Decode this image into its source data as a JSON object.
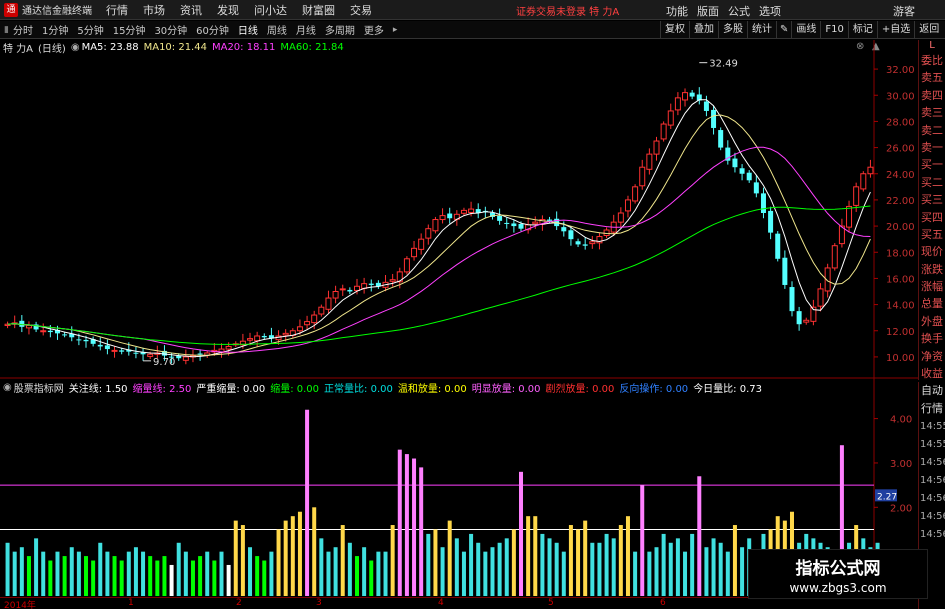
{
  "menubar": {
    "logo": "通",
    "title": "通达信金融终端",
    "items": [
      "行情",
      "市场",
      "资讯",
      "发现",
      "问小达",
      "财富圈",
      "交易"
    ],
    "trade_status": "证券交易未登录  特 力A",
    "right_items": [
      "功能",
      "版面",
      "公式",
      "选项"
    ],
    "guest": "游客"
  },
  "toolbar": {
    "periods": [
      "分时",
      "1分钟",
      "5分钟",
      "15分钟",
      "30分钟",
      "60分钟",
      "日线",
      "周线",
      "月线",
      "多周期",
      "更多"
    ],
    "active": "日线",
    "buttons": [
      "复权",
      "叠加",
      "多股",
      "统计",
      "画线",
      "F10",
      "标记",
      "+自选",
      "返回"
    ]
  },
  "stock_info": {
    "name": "特 力A",
    "period": "(日线)",
    "ma5": "MA5: 23.88",
    "ma10": "MA10: 21.44",
    "ma20": "MA20: 18.11",
    "ma60": "MA60: 21.84",
    "colors": {
      "ma5": "#ffffff",
      "ma10": "#f0e68c",
      "ma20": "#ff40ff",
      "ma60": "#00ff00"
    }
  },
  "side_labels": [
    "委比",
    "卖五",
    "卖四",
    "卖三",
    "卖二",
    "卖一",
    "买一",
    "买二",
    "买三",
    "买四",
    "买五",
    "现价",
    "涨跌",
    "涨幅",
    "总量",
    "外盘",
    "换手",
    "净资",
    "收益"
  ],
  "side2_labels": [
    "自动",
    "行情"
  ],
  "side2_times": [
    "14:55",
    "14:55",
    "14:56",
    "14:56",
    "14:56",
    "14:56",
    "14:56"
  ],
  "indicator": {
    "name": "股票指标网",
    "items": [
      {
        "label": "关注线: 1.50",
        "color": "#ffffff"
      },
      {
        "label": "缩量线: 2.50",
        "color": "#ff40ff"
      },
      {
        "label": "严重缩量: 0.00",
        "color": "#ffffff"
      },
      {
        "label": "缩量: 0.00",
        "color": "#00ff00"
      },
      {
        "label": "正常量比: 0.00",
        "color": "#00e0e0"
      },
      {
        "label": "温和放量: 0.00",
        "color": "#ffff00"
      },
      {
        "label": "明显放量: 0.00",
        "color": "#ff60ff"
      },
      {
        "label": "剧烈放量: 0.00",
        "color": "#ff3030"
      },
      {
        "label": "反向操作: 0.00",
        "color": "#3080ff"
      },
      {
        "label": "今日量比: 0.73",
        "color": "#ffffff"
      }
    ]
  },
  "watermark": {
    "title": "指标公式网",
    "url": "www.zbgs3.com"
  },
  "x_labels": [
    "2014年",
    "1",
    "2",
    "3",
    "4",
    "5",
    "6"
  ],
  "chart_data": [
    {
      "type": "candlestick",
      "y_ticks": [
        "10.00",
        "12.00",
        "14.00",
        "16.00",
        "18.00",
        "20.00",
        "22.00",
        "24.00",
        "26.00",
        "28.00",
        "30.00",
        "32.00"
      ],
      "ylim": [
        9,
        33
      ],
      "annotations": [
        {
          "text": "32.49",
          "value": 32.49
        },
        {
          "text": "9.70",
          "value": 9.7
        }
      ],
      "close": [
        12.5,
        12.6,
        12.3,
        12.4,
        12.1,
        12.0,
        11.9,
        11.8,
        11.7,
        11.5,
        11.3,
        11.2,
        11.0,
        10.8,
        10.6,
        10.5,
        10.4,
        10.4,
        10.3,
        10.2,
        10.2,
        10.3,
        10.1,
        10.0,
        9.9,
        10.0,
        10.1,
        10.2,
        10.3,
        10.5,
        10.6,
        10.8,
        11.0,
        11.2,
        11.4,
        11.6,
        11.5,
        11.4,
        11.6,
        11.8,
        12.0,
        12.3,
        12.7,
        13.2,
        13.8,
        14.5,
        15.0,
        15.2,
        15.0,
        15.4,
        15.6,
        15.5,
        15.4,
        15.7,
        15.9,
        16.5,
        17.5,
        18.3,
        19.0,
        19.8,
        20.5,
        20.8,
        20.6,
        20.9,
        21.2,
        21.3,
        21.0,
        21.1,
        20.7,
        20.4,
        20.2,
        20.0,
        19.8,
        20.1,
        20.3,
        20.5,
        20.4,
        20.0,
        19.6,
        19.0,
        18.6,
        18.5,
        18.8,
        19.2,
        19.7,
        20.3,
        21.0,
        22.0,
        23.0,
        24.5,
        25.5,
        26.5,
        27.8,
        28.8,
        29.8,
        30.2,
        29.9,
        29.6,
        28.8,
        27.5,
        26.0,
        25.0,
        24.5,
        24.0,
        23.5,
        22.5,
        21.0,
        19.5,
        17.5,
        15.5,
        13.5,
        12.5,
        12.8,
        13.8,
        15.2,
        16.8,
        18.5,
        20.0,
        21.5,
        23.0,
        24.0,
        24.5
      ],
      "volume_ratio": [
        1.2,
        1.0,
        1.1,
        0.9,
        1.3,
        1.0,
        0.8,
        1.0,
        0.9,
        1.1,
        1.0,
        0.9,
        0.8,
        1.2,
        1.0,
        0.9,
        0.8,
        1.0,
        1.1,
        1.0,
        0.9,
        0.8,
        0.9,
        0.7,
        1.2,
        1.0,
        0.8,
        0.9,
        1.0,
        0.8,
        1.0,
        0.7,
        1.7,
        1.6,
        1.1,
        0.9,
        0.8,
        1.0,
        1.5,
        1.7,
        1.8,
        1.9,
        4.2,
        2.0,
        1.3,
        1.0,
        1.1,
        1.6,
        1.2,
        0.9,
        1.1,
        0.8,
        1.0,
        1.0,
        1.6,
        3.3,
        3.2,
        3.1,
        2.9,
        1.4,
        1.5,
        1.1,
        1.7,
        1.3,
        1.0,
        1.4,
        1.2,
        1.0,
        1.1,
        1.2,
        1.3,
        1.5,
        2.8,
        1.8,
        1.8,
        1.4,
        1.3,
        1.2,
        1.0,
        1.6,
        1.5,
        1.7,
        1.2,
        1.2,
        1.4,
        1.3,
        1.6,
        1.8,
        1.0,
        2.5,
        1.0,
        1.1,
        1.4,
        1.2,
        1.3,
        1.0,
        1.4,
        2.7,
        1.1,
        1.3,
        1.2,
        1.0,
        1.6,
        1.1,
        1.3,
        1.0,
        1.4,
        1.5,
        1.8,
        1.7,
        1.9,
        1.2,
        1.4,
        1.3,
        1.2,
        1.1,
        1.0,
        3.4,
        1.2,
        1.6,
        1.3,
        1.1,
        1.2
      ]
    },
    {
      "type": "bar",
      "name": "volume_ratio",
      "y_ticks": [
        "2.00",
        "3.00",
        "4.00"
      ],
      "ylim": [
        0,
        4.6
      ],
      "level_labels": [
        "2.27"
      ],
      "level_values": [
        2.27
      ]
    }
  ]
}
